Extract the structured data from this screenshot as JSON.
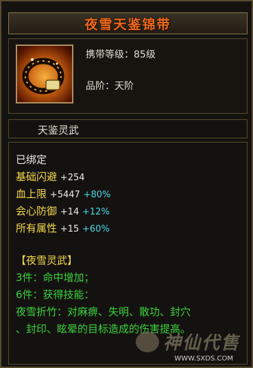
{
  "item": {
    "name": "夜雪天鉴锦带",
    "level_req": "携带等级：85级",
    "grade": "品阶：天阶",
    "series": "天鉴灵武"
  },
  "status": "已绑定",
  "attributes": [
    {
      "name": "基础闪避",
      "value": "+254",
      "percent": ""
    },
    {
      "name": "血上限",
      "value": "+5447",
      "percent": "+80%"
    },
    {
      "name": "会心防御",
      "value": "+14",
      "percent": "+12%"
    },
    {
      "name": "所有属性",
      "value": "+15",
      "percent": "+60%"
    }
  ],
  "set": {
    "title": "【夜雪灵武】",
    "bonus_3": "3件：命中增加；",
    "bonus_6": "6件：获得技能：",
    "skill_line1": "夜雪折竹：对麻痹、失明、散功、封穴",
    "skill_line2": "、封印、眩晕的目标造成的伤害提高。"
  },
  "watermark": {
    "text": "神仙代售",
    "url": "WWW.SXDS.COM"
  },
  "colors": {
    "title": "#f06a1e",
    "attribute_name": "#f5d84c",
    "percent": "#4cd8e8",
    "set_text": "#3cd23c"
  },
  "icons": [
    "belt-icon"
  ]
}
